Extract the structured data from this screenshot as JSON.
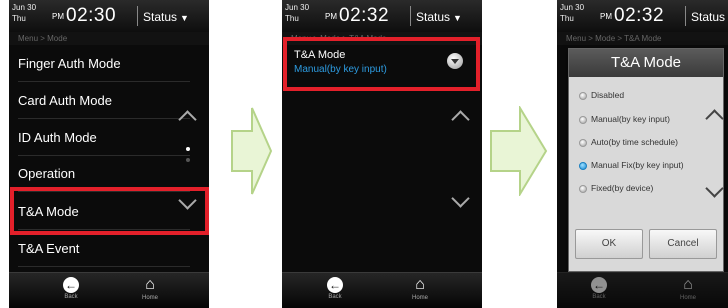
{
  "screens": [
    {
      "date_day": "Jun  30",
      "date_dow": "Thu",
      "ampm": "PM",
      "time": "02:30",
      "status_label": "Status",
      "breadcrumb": "Menu  >  Mode",
      "menu_items": [
        "Finger Auth Mode",
        "Card Auth Mode",
        "ID Auth Mode",
        "Operation",
        "T&A Mode",
        "T&A Event"
      ],
      "back_label": "Back",
      "home_label": "Home"
    },
    {
      "date_day": "Jun  30",
      "date_dow": "Thu",
      "ampm": "PM",
      "time": "02:32",
      "status_label": "Status",
      "breadcrumb": "Menu  >  Mode  >  T&A Mode",
      "setting_title": "T&A Mode",
      "setting_value": "Manual(by key input)",
      "back_label": "Back",
      "home_label": "Home"
    },
    {
      "date_day": "Jun  30",
      "date_dow": "Thu",
      "ampm": "PM",
      "time": "02:32",
      "status_label": "Status",
      "breadcrumb": "Menu  >  Mode  >  T&A Mode",
      "dialog_title": "T&A Mode",
      "options": [
        "Disabled",
        "Manual(by key input)",
        "Auto(by time schedule)",
        "Manual Fix(by key input)",
        "Fixed(by device)"
      ],
      "selected_option": "Manual Fix(by key input)",
      "ok_label": "OK",
      "cancel_label": "Cancel",
      "back_label": "Back",
      "home_label": "Home"
    }
  ],
  "colors": {
    "highlight": "#e3202a",
    "accent_value": "#2d9be0",
    "arrow_fill": "#e9f5d6",
    "arrow_stroke": "#b5d389"
  },
  "icons": [
    "chevron-up-icon",
    "chevron-down-icon",
    "back-icon",
    "home-icon",
    "dropdown-icon",
    "radio-icon",
    "next-step-arrow"
  ]
}
